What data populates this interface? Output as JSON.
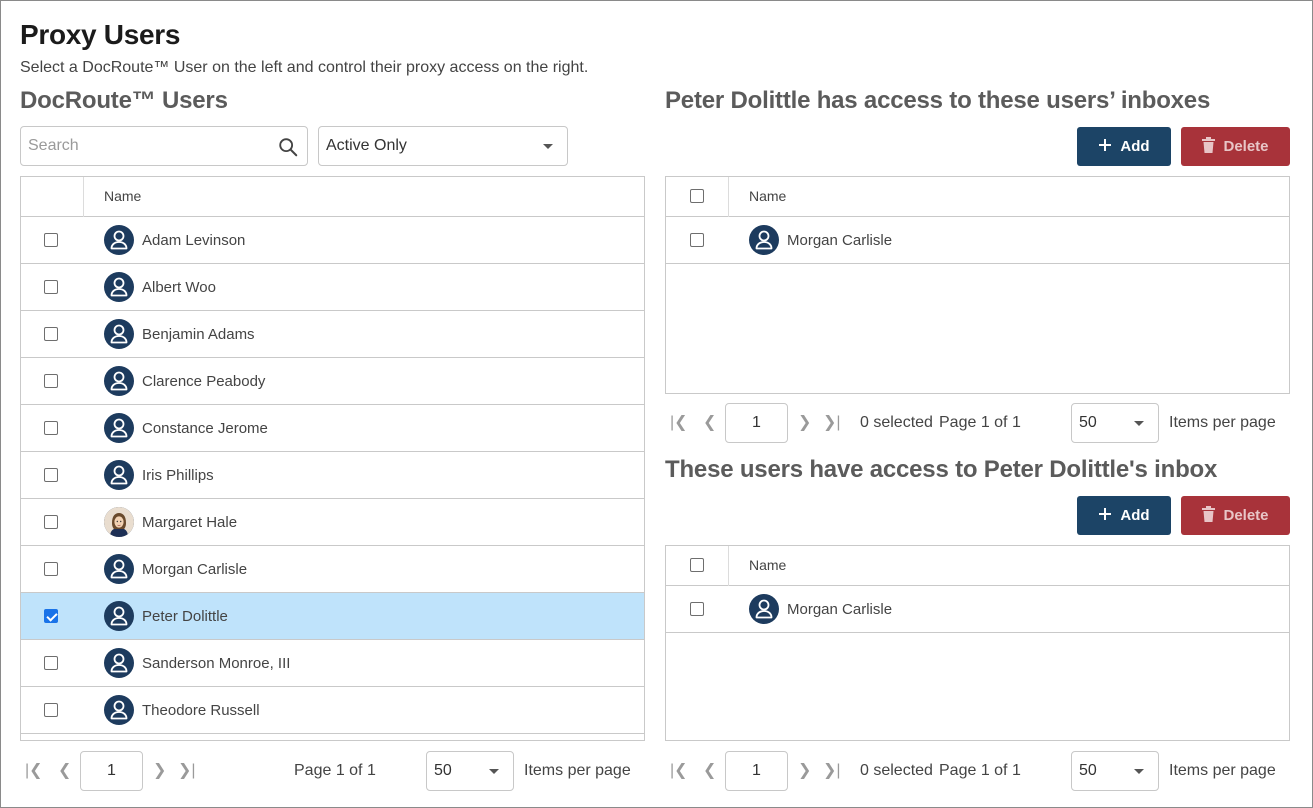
{
  "page": {
    "title": "Proxy Users",
    "subtitle": "Select a DocRoute™ User on the left and control their proxy access on the right."
  },
  "left": {
    "title": "DocRoute™ Users",
    "search_placeholder": "Search",
    "filter_value": "Active Only",
    "column_name": "Name",
    "users": [
      {
        "name": "Adam Levinson",
        "checked": false,
        "avatar": "user-icon"
      },
      {
        "name": "Albert Woo",
        "checked": false,
        "avatar": "user-icon"
      },
      {
        "name": "Benjamin Adams",
        "checked": false,
        "avatar": "user-icon"
      },
      {
        "name": "Clarence Peabody",
        "checked": false,
        "avatar": "user-icon"
      },
      {
        "name": "Constance Jerome",
        "checked": false,
        "avatar": "user-icon"
      },
      {
        "name": "Iris Phillips",
        "checked": false,
        "avatar": "user-icon"
      },
      {
        "name": "Margaret Hale",
        "checked": false,
        "avatar": "photo"
      },
      {
        "name": "Morgan Carlisle",
        "checked": false,
        "avatar": "user-icon"
      },
      {
        "name": "Peter Dolittle",
        "checked": true,
        "avatar": "user-icon"
      },
      {
        "name": "Sanderson Monroe, III",
        "checked": false,
        "avatar": "user-icon"
      },
      {
        "name": "Theodore Russell",
        "checked": false,
        "avatar": "user-icon"
      }
    ],
    "pager": {
      "page_input": "1",
      "page_text": "Page 1 of 1",
      "per_page": "50",
      "per_page_label": "Items per page"
    }
  },
  "right_top": {
    "title": "Peter Dolittle has access to these users’ inboxes",
    "add_label": "Add",
    "delete_label": "Delete",
    "column_name": "Name",
    "users": [
      {
        "name": "Morgan Carlisle",
        "checked": false
      }
    ],
    "pager": {
      "page_input": "1",
      "selected_text": "0 selected",
      "page_text": "Page 1 of 1",
      "per_page": "50",
      "per_page_label": "Items per page"
    }
  },
  "right_bottom": {
    "title": "These users have access to Peter Dolittle's inbox",
    "add_label": "Add",
    "delete_label": "Delete",
    "column_name": "Name",
    "users": [
      {
        "name": "Morgan Carlisle",
        "checked": false
      }
    ],
    "pager": {
      "page_input": "1",
      "selected_text": "0 selected",
      "page_text": "Page 1 of 1",
      "per_page": "50",
      "per_page_label": "Items per page"
    }
  },
  "colors": {
    "primary": "#1c4466",
    "danger": "#a8333a",
    "selected_row": "#bfe3fb",
    "avatar_bg": "#1d3b5e"
  }
}
